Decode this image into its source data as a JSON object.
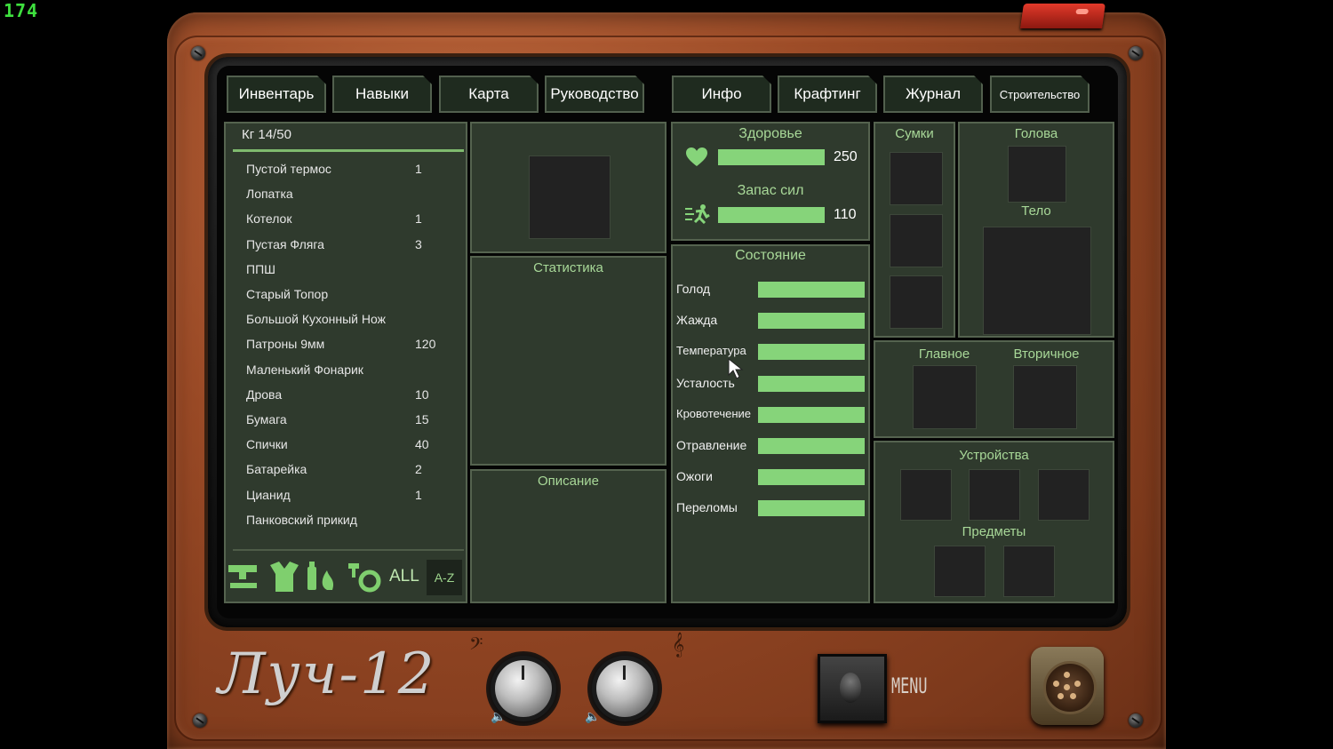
{
  "fps_counter": "174",
  "tabs_left": [
    "Инвентарь",
    "Навыки",
    "Карта",
    "Руководство"
  ],
  "tabs_right": [
    "Инфо",
    "Крафтинг",
    "Журнал",
    "Строительство"
  ],
  "inventory": {
    "weight": "Кг 14/50",
    "items": [
      {
        "name": "Пустой термос",
        "qty": "1"
      },
      {
        "name": "Лопатка",
        "qty": ""
      },
      {
        "name": "Котелок",
        "qty": "1"
      },
      {
        "name": "Пустая Фляга",
        "qty": "3"
      },
      {
        "name": "ППШ",
        "qty": ""
      },
      {
        "name": "Старый Топор",
        "qty": ""
      },
      {
        "name": "Большой Кухонный Нож",
        "qty": ""
      },
      {
        "name": "Патроны 9мм",
        "qty": "120"
      },
      {
        "name": "Маленький Фонарик",
        "qty": ""
      },
      {
        "name": "Дрова",
        "qty": "10"
      },
      {
        "name": "Бумага",
        "qty": "15"
      },
      {
        "name": "Спички",
        "qty": "40"
      },
      {
        "name": "Батарейка",
        "qty": "2"
      },
      {
        "name": "Цианид",
        "qty": "1"
      },
      {
        "name": "Панковский прикид",
        "qty": ""
      }
    ],
    "filters": {
      "icons": [
        "weapon-filter-icon",
        "clothing-filter-icon",
        "consumables-filter-icon",
        "tools-filter-icon"
      ],
      "all_label": "ALL",
      "sort_label": "A-Z"
    }
  },
  "middle": {
    "stats_title": "Статистика",
    "description_title": "Описание"
  },
  "vitals": {
    "health_label": "Здоровье",
    "health_value": "250",
    "health_fraction": 1.0,
    "stamina_label": "Запас сил",
    "stamina_value": "110",
    "stamina_fraction": 1.0
  },
  "condition": {
    "title": "Состояние",
    "rows": [
      {
        "label": "Голод",
        "fraction": 1.0
      },
      {
        "label": "Жажда",
        "fraction": 1.0
      },
      {
        "label": "Температура",
        "fraction": 1.0
      },
      {
        "label": "Усталость",
        "fraction": 1.0
      },
      {
        "label": "Кровотечение",
        "fraction": 1.0
      },
      {
        "label": "Отравление",
        "fraction": 1.0
      },
      {
        "label": "Ожоги",
        "fraction": 1.0
      },
      {
        "label": "Переломы",
        "fraction": 1.0
      }
    ]
  },
  "equipment": {
    "bags_title": "Сумки",
    "head_title": "Голова",
    "body_title": "Тело",
    "primary_title": "Главное",
    "secondary_title": "Вторичное",
    "devices_title": "Устройства",
    "items_title": "Предметы"
  },
  "device": {
    "logo": "Луч-12",
    "menu_label": "MENU"
  },
  "colors": {
    "panel_bg": "#2f3a2d",
    "accent_green": "#86d47a",
    "title_green": "#a8d898",
    "casing_orange": "#9a4a26"
  }
}
